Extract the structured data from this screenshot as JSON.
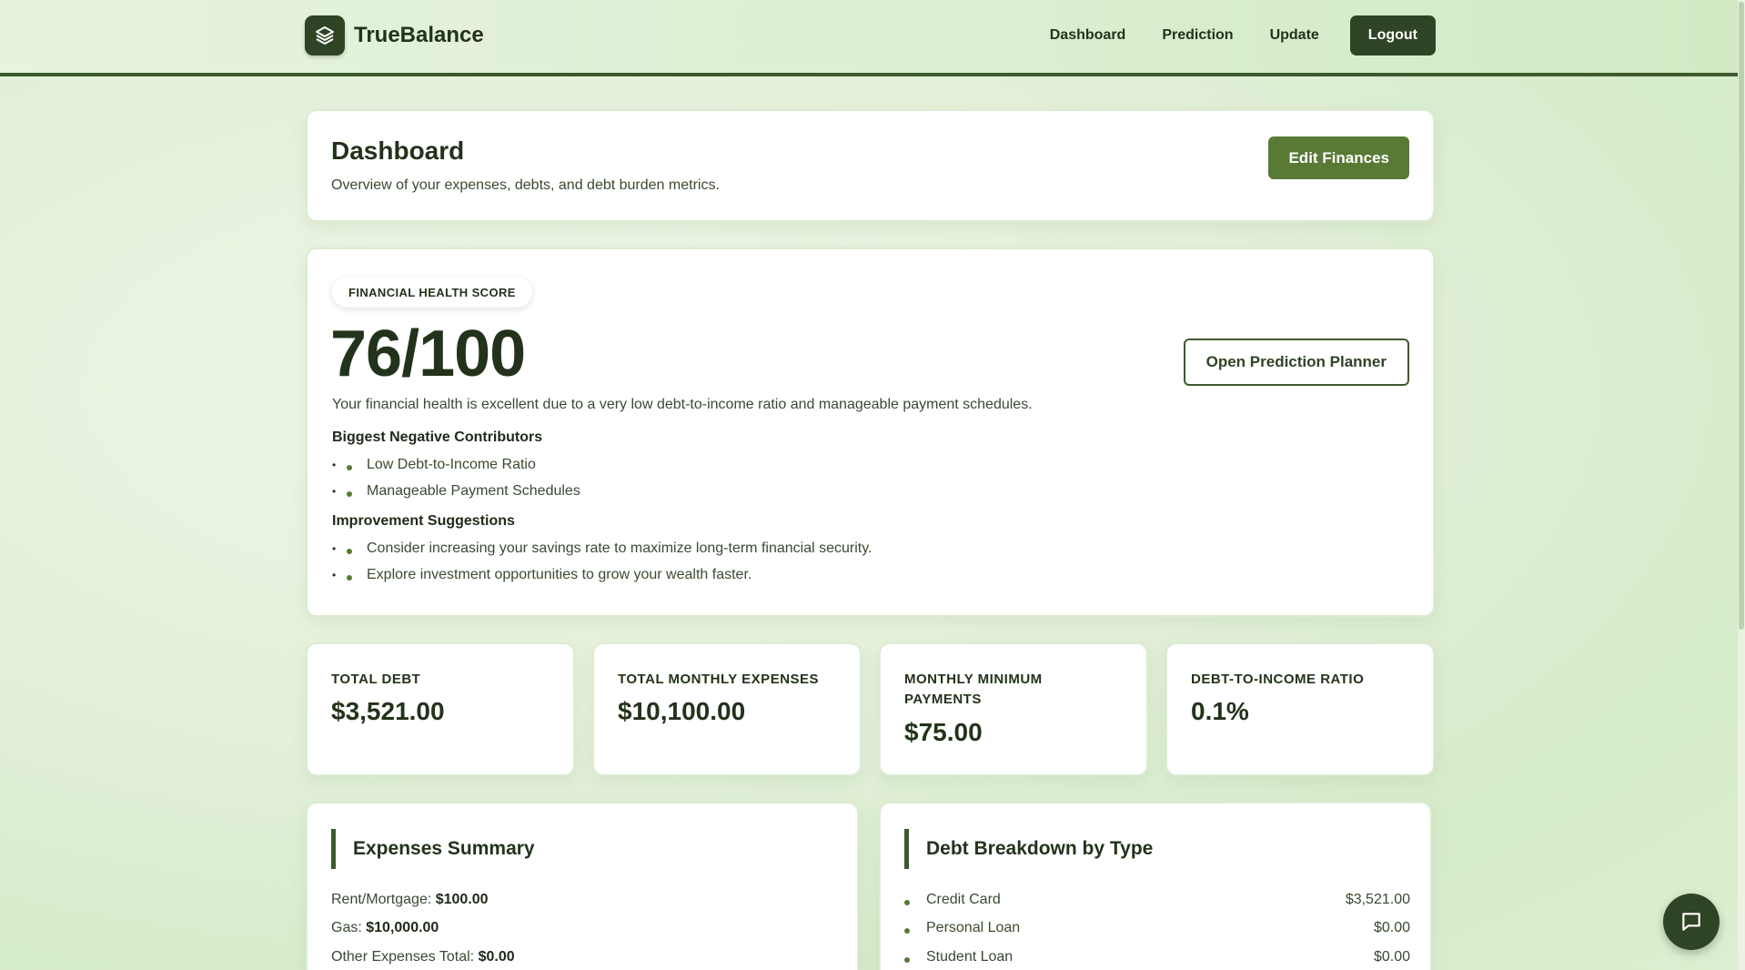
{
  "brand": {
    "name": "TrueBalance",
    "logo_icon": "layers-icon"
  },
  "nav": {
    "items": [
      "Dashboard",
      "Prediction",
      "Update"
    ],
    "logout": "Logout"
  },
  "dashboard": {
    "title": "Dashboard",
    "subtitle": "Overview of your expenses, debts, and debt burden metrics.",
    "edit_button": "Edit Finances"
  },
  "health": {
    "pill": "FINANCIAL HEALTH SCORE",
    "score": "76/100",
    "description": "Your financial health is excellent due to a very low debt-to-income ratio and manageable payment schedules.",
    "planner_button": "Open Prediction Planner",
    "negatives_title": "Biggest Negative Contributors",
    "negatives": [
      "Low Debt-to-Income Ratio",
      "Manageable Payment Schedules"
    ],
    "suggestions_title": "Improvement Suggestions",
    "suggestions": [
      "Consider increasing your savings rate to maximize long-term financial security.",
      "Explore investment opportunities to grow your wealth faster."
    ]
  },
  "stats": [
    {
      "label": "TOTAL DEBT",
      "value": "$3,521.00"
    },
    {
      "label": "TOTAL MONTHLY EXPENSES",
      "value": "$10,100.00"
    },
    {
      "label": "MONTHLY MINIMUM PAYMENTS",
      "value": "$75.00"
    },
    {
      "label": "DEBT-TO-INCOME RATIO",
      "value": "0.1%"
    }
  ],
  "expenses": {
    "title": "Expenses Summary",
    "lines": [
      {
        "label": "Rent/Mortgage:",
        "value": "$100.00"
      },
      {
        "label": "Gas:",
        "value": "$10,000.00"
      },
      {
        "label": "Other Expenses Total:",
        "value": "$0.00"
      }
    ]
  },
  "debts": {
    "title": "Debt Breakdown by Type",
    "rows": [
      {
        "type": "Credit Card",
        "amount": "$3,521.00"
      },
      {
        "type": "Personal Loan",
        "amount": "$0.00"
      },
      {
        "type": "Student Loan",
        "amount": "$0.00"
      }
    ]
  },
  "chat": {
    "icon": "chat-bubble-icon"
  },
  "colors": {
    "primary": "#2f4424",
    "accent": "#587a35",
    "border": "#3c5a2c"
  }
}
